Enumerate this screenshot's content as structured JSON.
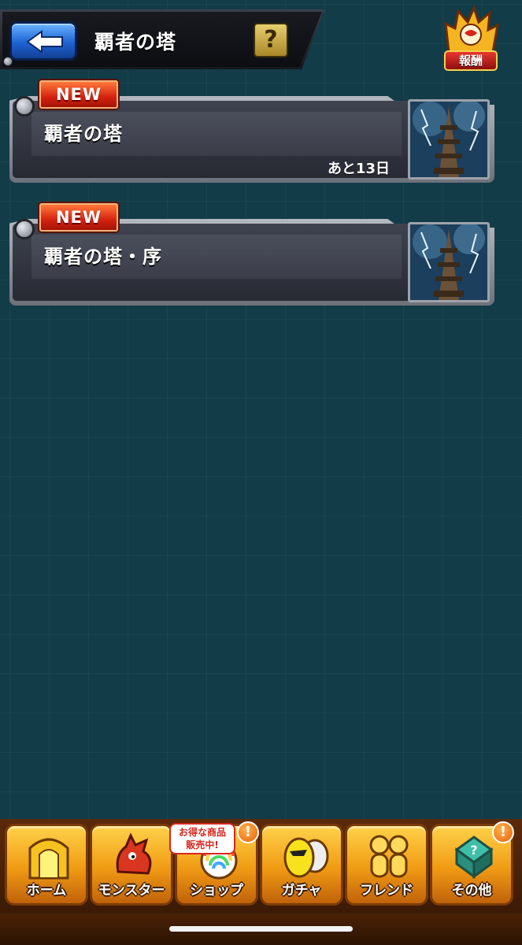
{
  "header": {
    "title": "覇者の塔",
    "help_label": "?"
  },
  "reward": {
    "label": "報酬"
  },
  "quests": [
    {
      "badge": "NEW",
      "title": "覇者の塔",
      "remaining": "あと13日"
    },
    {
      "badge": "NEW",
      "title": "覇者の塔・序",
      "remaining": ""
    }
  ],
  "nav": {
    "home": "ホーム",
    "monster": "モンスター",
    "shop": "ショップ",
    "shop_promo_line1": "お得な商品",
    "shop_promo_line2": "販売中!",
    "gacha": "ガチャ",
    "friend": "フレンド",
    "other": "その他",
    "alert_mark": "!"
  },
  "colors": {
    "background": "#123c48",
    "back_button": "#1e63d3",
    "new_badge": "#d5220f",
    "nav_gold": "#f09b14"
  }
}
